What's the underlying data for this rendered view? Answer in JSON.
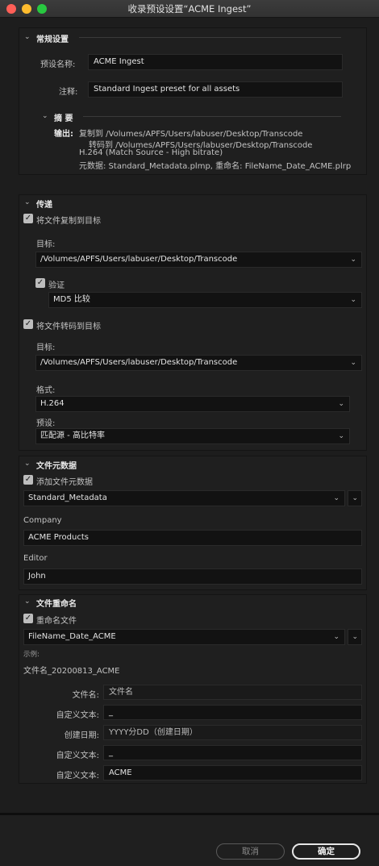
{
  "window": {
    "title": "收录预设设置“ACME Ingest”"
  },
  "general": {
    "header": "常规设置",
    "name_label": "预设名称:",
    "name_value": "ACME Ingest",
    "note_label": "注释:",
    "note_value": "Standard Ingest preset for all assets",
    "summary_header": "摘 要",
    "output_label": "输出:",
    "summary_lines": [
      "复制到 /Volumes/APFS/Users/labuser/Desktop/Transcode",
      "转码到 /Volumes/APFS/Users/labuser/Desktop/Transcode",
      "H.264 (Match Source - High bitrate)",
      "元数据: Standard_Metadata.plmp, 重命名: FileName_Date_ACME.plrp"
    ]
  },
  "transfer": {
    "header": "传递",
    "copy_label": "将文件复制到目标",
    "copy_target_label": "目标:",
    "copy_target_value": "/Volumes/APFS/Users/labuser/Desktop/Transcode",
    "verify_label": "验证",
    "verify_value": "MD5 比较",
    "transcode_label": "将文件转码到目标",
    "transcode_target_label": "目标:",
    "transcode_target_value": "/Volumes/APFS/Users/labuser/Desktop/Transcode",
    "format_label": "格式:",
    "format_value": "H.264",
    "preset_label": "预设:",
    "preset_value": "匹配源 - 高比特率"
  },
  "metadata": {
    "header": "文件元数据",
    "add_label": "添加文件元数据",
    "template_value": "Standard_Metadata",
    "company_label": "Company",
    "company_value": "ACME Products",
    "editor_label": "Editor",
    "editor_value": "John"
  },
  "rename": {
    "header": "文件重命名",
    "rename_label": "重命名文件",
    "template_value": "FileName_Date_ACME",
    "example_label": "示例:",
    "example_value": "文件名_20200813_ACME",
    "rows": [
      {
        "label": "文件名:",
        "value": "文件名"
      },
      {
        "label": "自定义文本:",
        "value": "_"
      },
      {
        "label": "创建日期:",
        "value": "YYYY分DD（创建日期）"
      },
      {
        "label": "自定义文本:",
        "value": "_"
      },
      {
        "label": "自定义文本:",
        "value": "ACME"
      }
    ]
  },
  "footer": {
    "cancel": "取消",
    "ok": "确定"
  },
  "colors": {
    "close": "#fc5f57",
    "minimize": "#fdbc2e",
    "zoom": "#28c840",
    "accent_border": "#e6e6e6"
  }
}
